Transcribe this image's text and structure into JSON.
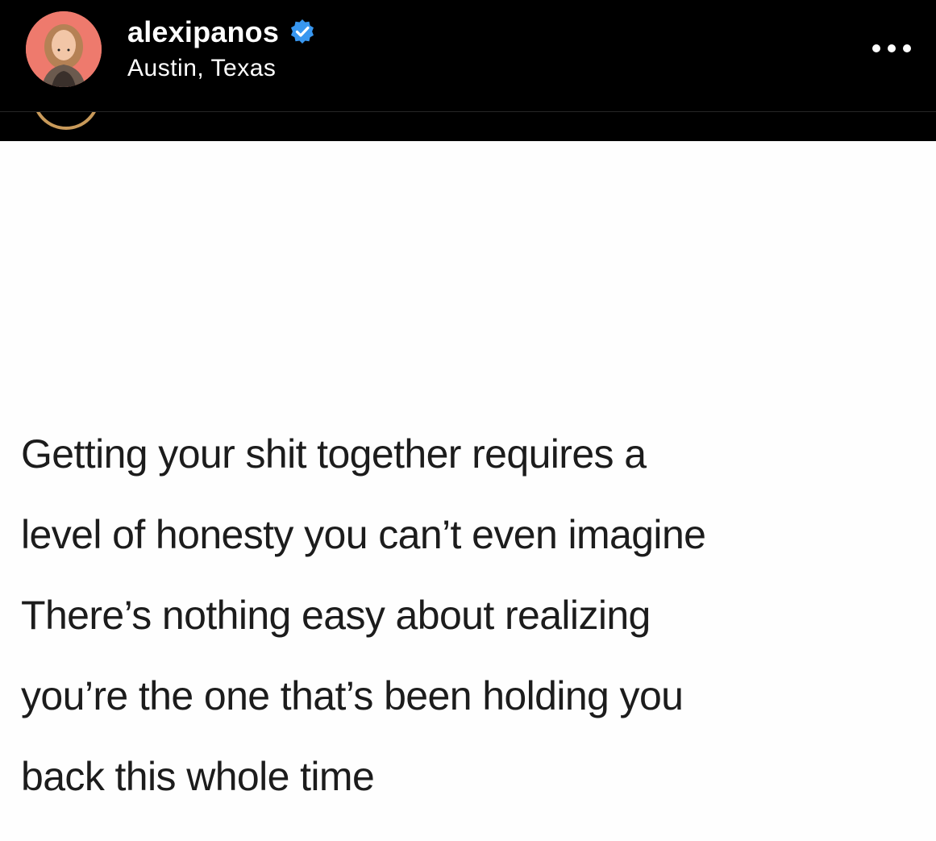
{
  "post_header": {
    "username": "alexipanos",
    "location": "Austin, Texas",
    "verified_icon": "verified-badge-icon",
    "more_icon": "more-options-icon",
    "verified_color": "#3897f0"
  },
  "post": {
    "quote_lines": [
      "Getting your shit together requires a",
      "level of honesty you can’t even imagine",
      "There’s nothing easy about realizing",
      "you’re the one that’s been holding you",
      "back this whole time"
    ]
  }
}
